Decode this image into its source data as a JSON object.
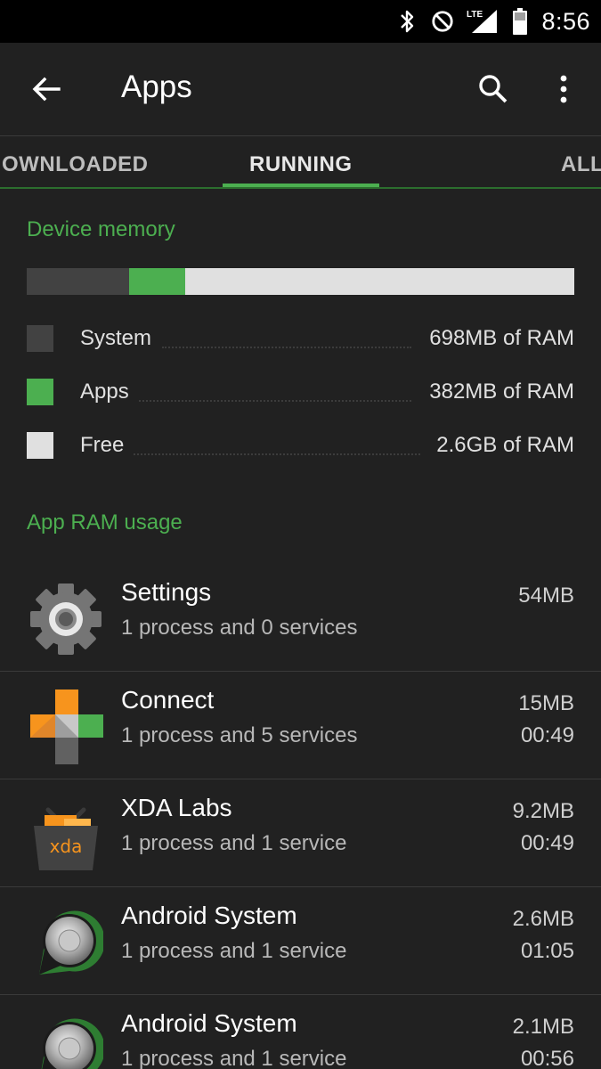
{
  "status_bar": {
    "icons": [
      "bluetooth-icon",
      "do-not-disturb-icon",
      "lte-signal-icon",
      "battery-icon"
    ],
    "network_label": "LTE",
    "time": "8:56"
  },
  "toolbar": {
    "title": "Apps",
    "icons": [
      "back-arrow-icon",
      "search-icon",
      "more-vert-icon"
    ]
  },
  "tabs": [
    {
      "label": "OWNLOADED",
      "active": false
    },
    {
      "label": "RUNNING",
      "active": true
    },
    {
      "label": "ALL",
      "active": false
    }
  ],
  "device_memory": {
    "header": "Device memory",
    "bar_fractions": {
      "system": 0.187,
      "apps": 0.102,
      "free": 0.711
    },
    "legend": [
      {
        "label": "System",
        "value": "698MB of RAM",
        "color": "#424242"
      },
      {
        "label": "Apps",
        "value": "382MB of RAM",
        "color": "#4caf50"
      },
      {
        "label": "Free",
        "value": "2.6GB of RAM",
        "color": "#e0e0e0"
      }
    ]
  },
  "app_ram": {
    "header": "App RAM usage",
    "apps": [
      {
        "name": "Settings",
        "desc": "1 process and 0 services",
        "size": "54MB",
        "time": "",
        "icon": "settings-gear-icon"
      },
      {
        "name": "Connect",
        "desc": "1 process and 5 services",
        "size": "15MB",
        "time": "00:49",
        "icon": "connect-cross-icon"
      },
      {
        "name": "XDA Labs",
        "desc": "1 process and 1 service",
        "size": "9.2MB",
        "time": "00:49",
        "icon": "xda-basket-icon"
      },
      {
        "name": "Android System",
        "desc": "1 process and 1 service",
        "size": "2.6MB",
        "time": "01:05",
        "icon": "android-system-icon"
      },
      {
        "name": "Android System",
        "desc": "1 process and 1 service",
        "size": "2.1MB",
        "time": "00:56",
        "icon": "android-system-icon"
      }
    ]
  },
  "colors": {
    "accent": "#4caf50",
    "background": "#212121",
    "status_bar": "#000000"
  }
}
